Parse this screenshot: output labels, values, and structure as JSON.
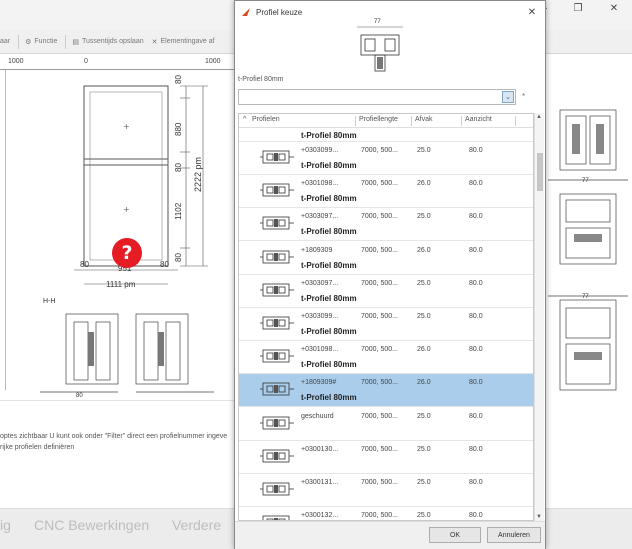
{
  "toolbar": {
    "items": [
      {
        "icon": "gear-icon",
        "label": "Functie"
      },
      {
        "icon": "save-icon",
        "label": "Tussentijds opslaan"
      },
      {
        "icon": "close-icon",
        "label": "Elementingave af"
      }
    ],
    "cut_label": "aar"
  },
  "ruler": {
    "labels": [
      "1000",
      "0",
      "1000"
    ]
  },
  "drawing": {
    "dim_total_h": "2222 pm",
    "dim_880": "880",
    "dim_80a": "80",
    "dim_80b": "80",
    "dim_1102": "1102",
    "dim_80c": "80",
    "dim_80d": "80",
    "dim_951": "951",
    "dim_80e": "80",
    "dim_width": "1111 pm",
    "section_label": "H-H",
    "bottom_80": "80",
    "help_symbol": "?"
  },
  "right_drawing": {
    "dim_top": "77",
    "dim_mid": "77"
  },
  "hint": {
    "line1": "optes zichtbaar U kunt ook onder \"Filter\" direct een profielnummer ingeve",
    "line2": "rijke profielen definiëren"
  },
  "bottom_tabs": [
    "ig",
    "CNC Bewerkingen",
    "Verdere"
  ],
  "dialog": {
    "title": "Profiel keuze",
    "close": "✕",
    "preview_dim": "77",
    "selected_label": "t-Profiel 80mm",
    "filter_value": "",
    "filter_star": "*",
    "columns": [
      "Profielen",
      "Profiellengte",
      "Afvak",
      "Aanzicht"
    ],
    "top_row_name": "t-Profiel 80mm",
    "rows": [
      {
        "code": "+0303099...",
        "len": "7000, 500...",
        "afk": "25.0",
        "aanz": "80.0",
        "name": "t-Profiel 80mm",
        "selected": false
      },
      {
        "code": "+0301098...",
        "len": "7000, 500...",
        "afk": "26.0",
        "aanz": "80.0",
        "name": "t-Profiel 80mm",
        "selected": false
      },
      {
        "code": "+0303097...",
        "len": "7000, 500...",
        "afk": "25.0",
        "aanz": "80.0",
        "name": "t-Profiel 80mm",
        "selected": false
      },
      {
        "code": "+1809309",
        "len": "7000, 500...",
        "afk": "26.0",
        "aanz": "80.0",
        "name": "t-Profiel 80mm",
        "selected": false
      },
      {
        "code": "+0303097...",
        "len": "7000, 500...",
        "afk": "25.0",
        "aanz": "80.0",
        "name": "t-Profiel 80mm",
        "selected": false
      },
      {
        "code": "+0303099...",
        "len": "7000, 500...",
        "afk": "25.0",
        "aanz": "80.0",
        "name": "t-Profiel 80mm",
        "selected": false
      },
      {
        "code": "+0301098...",
        "len": "7000, 500...",
        "afk": "26.0",
        "aanz": "80.0",
        "name": "t-Profiel 80mm",
        "selected": false
      },
      {
        "code": "+1809309#",
        "len": "7000, 500...",
        "afk": "26.0",
        "aanz": "80.0",
        "name": "t-Profiel 80mm",
        "selected": true
      },
      {
        "code": "geschuurd",
        "len": "7000, 500...",
        "afk": "25.0",
        "aanz": "80.0",
        "name": "",
        "selected": false
      },
      {
        "code": "+0300130...",
        "len": "7000, 500...",
        "afk": "25.0",
        "aanz": "80.0",
        "name": "",
        "selected": false
      },
      {
        "code": "+0300131...",
        "len": "7000, 500...",
        "afk": "25.0",
        "aanz": "80.0",
        "name": "",
        "selected": false
      },
      {
        "code": "+0300132...",
        "len": "7000, 500...",
        "afk": "25.0",
        "aanz": "80.0",
        "name": "",
        "selected": false
      }
    ],
    "ok_label": "OK",
    "cancel_label": "Annuleren"
  }
}
